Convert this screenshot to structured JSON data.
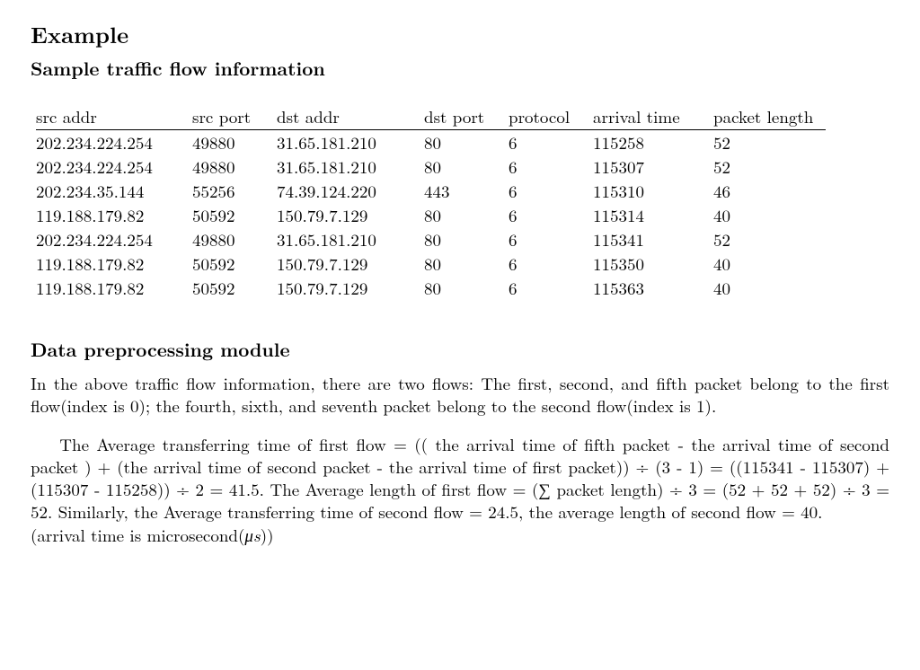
{
  "heading": "Example",
  "subhead1": "Sample traffic flow information",
  "table": {
    "headers": [
      "src addr",
      "src port",
      "dst addr",
      "dst port",
      "protocol",
      "arrival time",
      "packet length"
    ],
    "rows": [
      [
        "202.234.224.254",
        "49880",
        "31.65.181.210",
        "80",
        "6",
        "115258",
        "52"
      ],
      [
        "202.234.224.254",
        "49880",
        "31.65.181.210",
        "80",
        "6",
        "115307",
        "52"
      ],
      [
        "202.234.35.144",
        "55256",
        "74.39.124.220",
        "443",
        "6",
        "115310",
        "46"
      ],
      [
        "119.188.179.82",
        "50592",
        "150.79.7.129",
        "80",
        "6",
        "115314",
        "40"
      ],
      [
        "202.234.224.254",
        "49880",
        "31.65.181.210",
        "80",
        "6",
        "115341",
        "52"
      ],
      [
        "119.188.179.82",
        "50592",
        "150.79.7.129",
        "80",
        "6",
        "115350",
        "40"
      ],
      [
        "119.188.179.82",
        "50592",
        "150.79.7.129",
        "80",
        "6",
        "115363",
        "40"
      ]
    ]
  },
  "subhead2": "Data preprocessing module",
  "para1": "In the above traffic flow information, there are two flows: The first, second, and fifth packet belong to the first flow(index is 0); the fourth, sixth, and seventh packet belong to the second flow(index is 1).",
  "para2_pre": "The Average transferring time of first flow = (( the arrival time of fifth packet - the arrival time of second packet ) + (the arrival time of second packet - the arrival time of first packet)) ÷ (3 - 1) = ((115341 - 115307) + (115307 - 115258)) ÷ 2 = 41.5. The Average length of first flow = (∑ packet length) ÷ 3 = (52 + 52 + 52) ÷ 3 = 52. Similarly, the Average transferring time of second flow = 24.5, the average length of second flow = 40.",
  "para2_post_a": "(arrival time is microsecond(",
  "para2_post_mu": "μs",
  "para2_post_b": "))"
}
